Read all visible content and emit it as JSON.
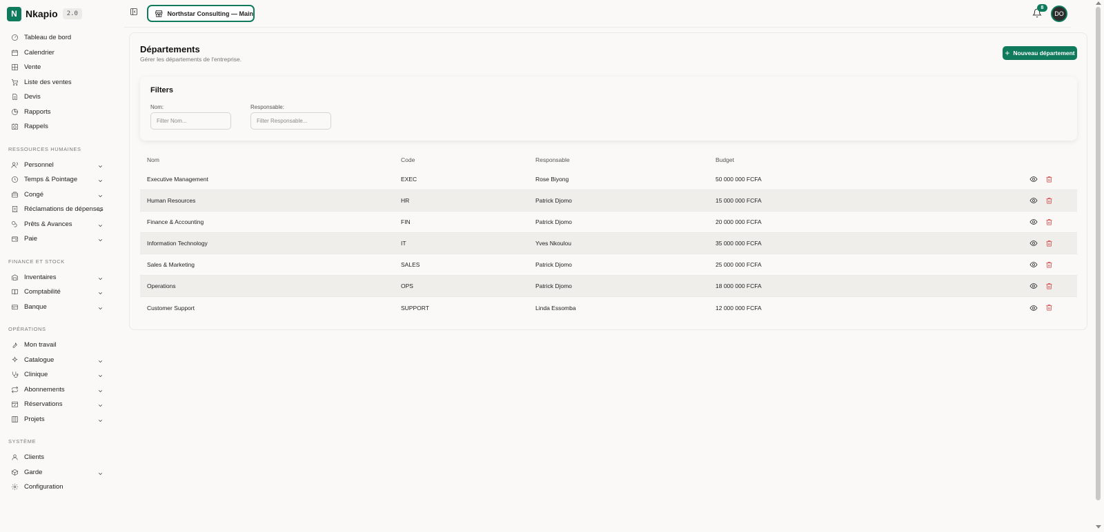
{
  "brand": {
    "initial": "N",
    "name": "Nkapio",
    "version": "2.0"
  },
  "sidebar": {
    "main_items": [
      {
        "label": "Tableau de bord",
        "icon": "dashboard-icon"
      },
      {
        "label": "Calendrier",
        "icon": "calendar-icon"
      },
      {
        "label": "Vente",
        "icon": "pos-icon"
      },
      {
        "label": "Liste des ventes",
        "icon": "cart-icon"
      },
      {
        "label": "Devis",
        "icon": "file-icon"
      },
      {
        "label": "Rapports",
        "icon": "pie-chart-icon"
      },
      {
        "label": "Rappels",
        "icon": "calendar-clock-icon"
      }
    ],
    "sections": [
      {
        "title": "RESSOURCES HUMAINES",
        "items": [
          {
            "label": "Personnel",
            "icon": "users-icon"
          },
          {
            "label": "Temps & Pointage",
            "icon": "clock-icon"
          },
          {
            "label": "Congé",
            "icon": "briefcase-icon"
          },
          {
            "label": "Réclamations de dépenses",
            "icon": "receipt-icon"
          },
          {
            "label": "Prêts & Avances",
            "icon": "coins-icon"
          },
          {
            "label": "Paie",
            "icon": "wallet-icon"
          }
        ]
      },
      {
        "title": "FINANCE ET STOCK",
        "items": [
          {
            "label": "Inventaires",
            "icon": "warehouse-icon"
          },
          {
            "label": "Comptabilité",
            "icon": "book-icon"
          },
          {
            "label": "Banque",
            "icon": "bank-icon"
          }
        ]
      },
      {
        "title": "OPÉRATIONS",
        "items": [
          {
            "label": "Mon travail",
            "icon": "wrench-icon"
          },
          {
            "label": "Catalogue",
            "icon": "sparkles-icon"
          },
          {
            "label": "Clinique",
            "icon": "stethoscope-icon"
          },
          {
            "label": "Abonnements",
            "icon": "repeat-icon"
          },
          {
            "label": "Réservations",
            "icon": "calendar-check-icon"
          },
          {
            "label": "Projets",
            "icon": "kanban-icon"
          }
        ]
      },
      {
        "title": "SYSTÈME",
        "items": [
          {
            "label": "Clients",
            "icon": "user-icon"
          },
          {
            "label": "Garde",
            "icon": "box-icon"
          },
          {
            "label": "Configuration",
            "icon": "settings-icon"
          }
        ]
      }
    ]
  },
  "topbar": {
    "company": "Northstar Consulting — Main",
    "notifications_count": "8",
    "avatar_initials": "DO"
  },
  "page": {
    "title": "Départements",
    "subtitle": "Gérer les départements de l'entreprise.",
    "new_button": "Nouveau département"
  },
  "filters": {
    "title": "Filters",
    "nom_label": "Nom:",
    "nom_placeholder": "Filter Nom...",
    "resp_label": "Responsable:",
    "resp_placeholder": "Filter Responsable..."
  },
  "table": {
    "headers": {
      "nom": "Nom",
      "code": "Code",
      "responsable": "Responsable",
      "budget": "Budget"
    },
    "rows": [
      {
        "nom": "Executive Management",
        "code": "EXEC",
        "responsable": "Rose Biyong",
        "budget": "50 000 000 FCFA"
      },
      {
        "nom": "Human Resources",
        "code": "HR",
        "responsable": "Patrick Djomo",
        "budget": "15 000 000 FCFA"
      },
      {
        "nom": "Finance & Accounting",
        "code": "FIN",
        "responsable": "Patrick Djomo",
        "budget": "20 000 000 FCFA"
      },
      {
        "nom": "Information Technology",
        "code": "IT",
        "responsable": "Yves Nkoulou",
        "budget": "35 000 000 FCFA"
      },
      {
        "nom": "Sales & Marketing",
        "code": "SALES",
        "responsable": "Patrick Djomo",
        "budget": "25 000 000 FCFA"
      },
      {
        "nom": "Operations",
        "code": "OPS",
        "responsable": "Patrick Djomo",
        "budget": "18 000 000 FCFA"
      },
      {
        "nom": "Customer Support",
        "code": "SUPPORT",
        "responsable": "Linda Essomba",
        "budget": "12 000 000 FCFA"
      }
    ]
  },
  "colors": {
    "accent": "#0f7a5c",
    "danger": "#d43a3a",
    "background": "#faf9f7"
  }
}
